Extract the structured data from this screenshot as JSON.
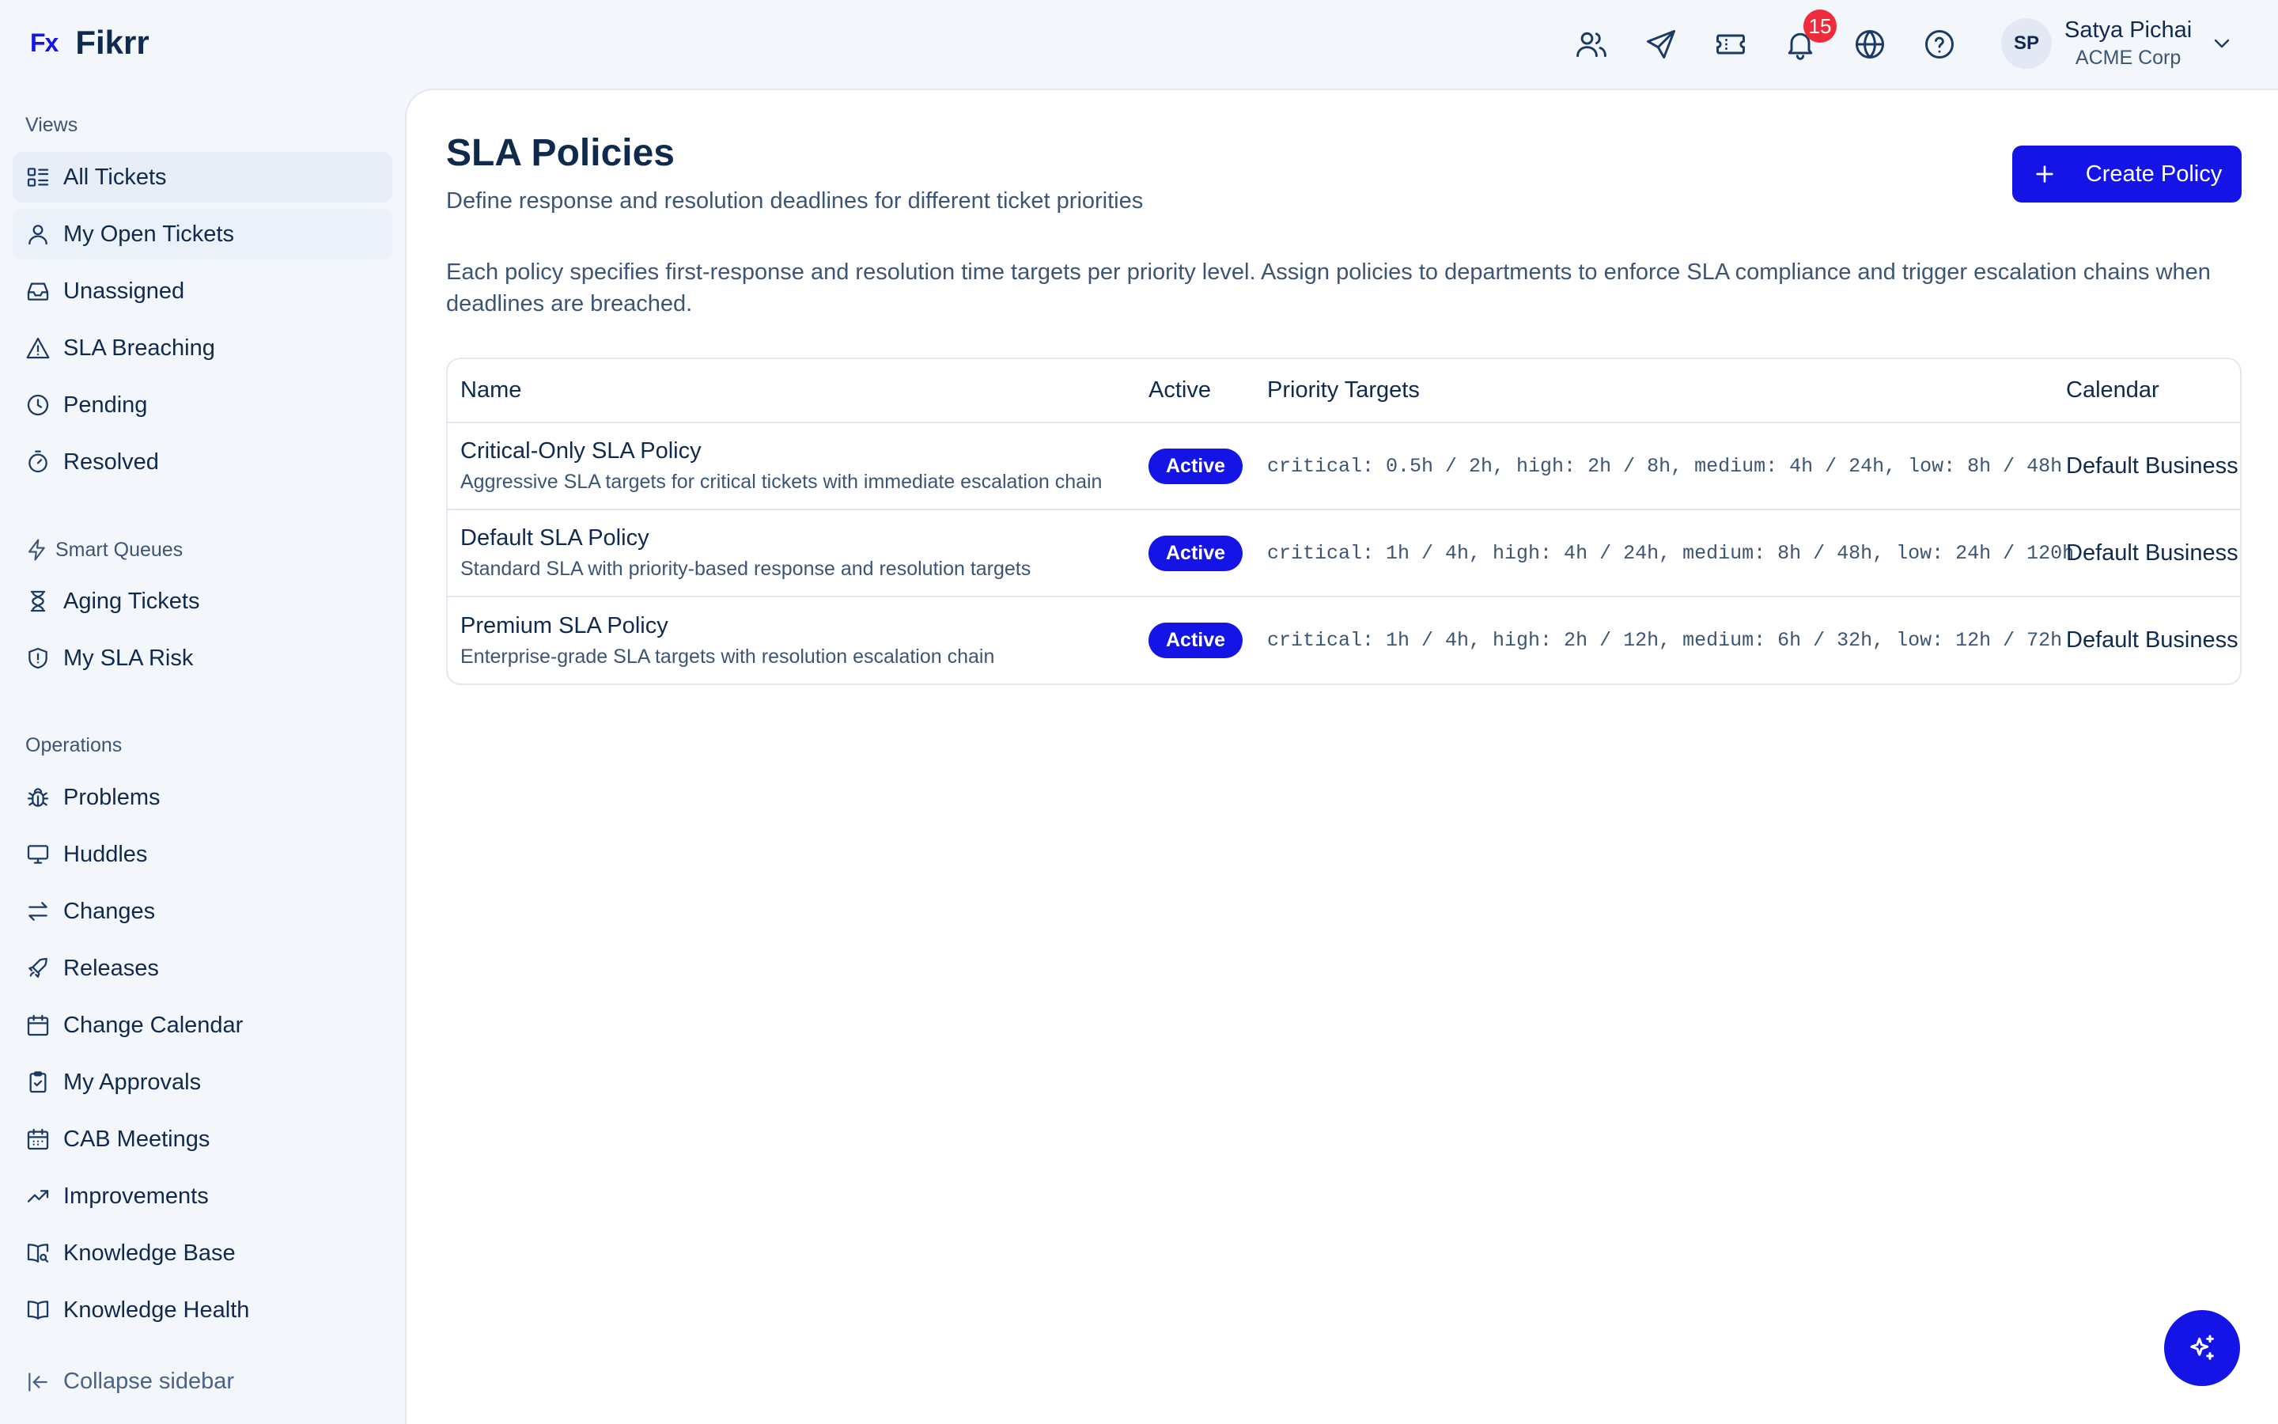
{
  "app": {
    "logo_mark": "Fx",
    "logo_text": "Fikrr"
  },
  "header": {
    "icons": [
      "users-icon",
      "send-icon",
      "ticket-icon",
      "bell-icon",
      "globe-icon",
      "help-icon"
    ],
    "notification_count": "15",
    "user": {
      "initials": "SP",
      "name": "Satya Pichai",
      "org": "ACME Corp"
    }
  },
  "sidebar": {
    "views_label": "Views",
    "views": [
      {
        "label": "All Tickets",
        "icon": "list-icon",
        "active": true
      },
      {
        "label": "My Open Tickets",
        "icon": "user-icon"
      },
      {
        "label": "Unassigned",
        "icon": "inbox-icon"
      },
      {
        "label": "SLA Breaching",
        "icon": "alert-triangle-icon"
      },
      {
        "label": "Pending",
        "icon": "clock-icon"
      },
      {
        "label": "Resolved",
        "icon": "timer-icon"
      }
    ],
    "smart_label": "Smart Queues",
    "smart": [
      {
        "label": "Aging Tickets",
        "icon": "hourglass-icon"
      },
      {
        "label": "My SLA Risk",
        "icon": "shield-icon"
      }
    ],
    "ops_label": "Operations",
    "ops": [
      {
        "label": "Problems",
        "icon": "bug-icon"
      },
      {
        "label": "Huddles",
        "icon": "monitor-icon"
      },
      {
        "label": "Changes",
        "icon": "arrows-swap-icon"
      },
      {
        "label": "Releases",
        "icon": "rocket-icon"
      },
      {
        "label": "Change Calendar",
        "icon": "calendar-icon"
      },
      {
        "label": "My Approvals",
        "icon": "clipboard-check-icon"
      },
      {
        "label": "CAB Meetings",
        "icon": "calendar-grid-icon"
      },
      {
        "label": "Improvements",
        "icon": "trending-up-icon"
      },
      {
        "label": "Knowledge Base",
        "icon": "book-search-icon"
      },
      {
        "label": "Knowledge Health",
        "icon": "book-open-icon"
      }
    ],
    "collapse_label": "Collapse sidebar"
  },
  "main": {
    "title": "SLA Policies",
    "subtitle": "Define response and resolution deadlines for different ticket priorities",
    "create_label": "Create Policy",
    "description": "Each policy specifies first-response and resolution time targets per priority level. Assign policies to departments to enforce SLA compliance and trigger escalation chains when deadlines are breached.",
    "table": {
      "columns": [
        "Name",
        "Active",
        "Priority Targets",
        "Calendar"
      ],
      "rows": [
        {
          "name": "Critical-Only SLA Policy",
          "description": "Aggressive SLA targets for critical tickets with immediate escalation chain",
          "active": "Active",
          "targets": "critical: 0.5h / 2h, high: 2h / 8h, medium: 4h / 24h, low: 8h / 48h",
          "calendar": "Default Business"
        },
        {
          "name": "Default SLA Policy",
          "description": "Standard SLA with priority-based response and resolution targets",
          "active": "Active",
          "targets": "critical: 1h / 4h, high: 4h / 24h, medium: 8h / 48h, low: 24h / 120h",
          "calendar": "Default Business"
        },
        {
          "name": "Premium SLA Policy",
          "description": "Enterprise-grade SLA targets with resolution escalation chain",
          "active": "Active",
          "targets": "critical: 1h / 4h, high: 2h / 12h, medium: 6h / 32h, low: 12h / 72h",
          "calendar": "Default Business"
        }
      ]
    }
  },
  "colors": {
    "accent": "#1414e6",
    "badge": "#ef2b3c",
    "text": "#0f2a4d",
    "muted": "#3d5574"
  }
}
